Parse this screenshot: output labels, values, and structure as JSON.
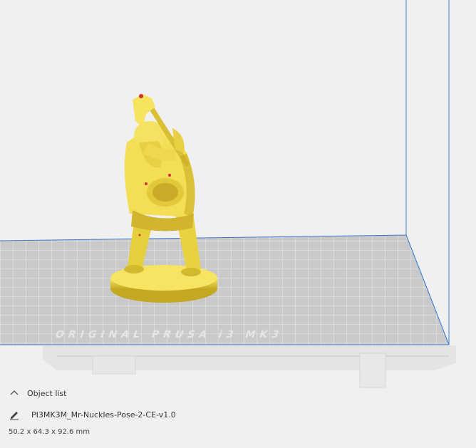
{
  "colors": {
    "background": "#f0f0f0",
    "build_volume_edge": "#3b7ad6",
    "build_plate": "#c9c9c9",
    "model": "#f5e25a",
    "model_shadow": "#b89e1a",
    "error_highlight": "#c8322a"
  },
  "viewport": {
    "plate_watermark": "ORIGINAL PRUSA i3 MK3"
  },
  "object_panel": {
    "toggle_label": "Object list",
    "toggle_icon": "chevron-up-icon",
    "edit_icon": "pencil-icon",
    "object_name": "PI3MK3M_Mr-Nuckles-Pose-2-CE-v1.0",
    "dimensions": "50.2 x 64.3 x 92.6 mm"
  }
}
